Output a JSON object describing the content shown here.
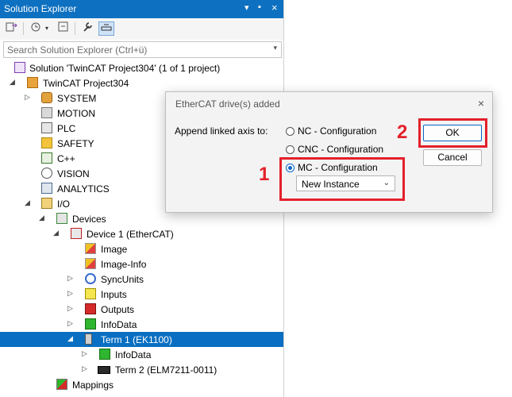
{
  "solution_explorer": {
    "title": "Solution Explorer",
    "title_controls": [
      "▾",
      "▪",
      "×"
    ],
    "search_placeholder": "Search Solution Explorer (Ctrl+ü)",
    "tree": [
      {
        "label": "Solution 'TwinCAT Project304' (1 of 1 project)",
        "icon": "solution-icon"
      },
      {
        "label": "TwinCAT Project304",
        "icon": "project-icon"
      },
      {
        "label": "SYSTEM",
        "icon": "system-icon"
      },
      {
        "label": "MOTION",
        "icon": "motion-icon"
      },
      {
        "label": "PLC",
        "icon": "plc-icon"
      },
      {
        "label": "SAFETY",
        "icon": "safety-icon"
      },
      {
        "label": "C++",
        "icon": "cpp-icon"
      },
      {
        "label": "VISION",
        "icon": "vision-icon"
      },
      {
        "label": "ANALYTICS",
        "icon": "analytics-icon"
      },
      {
        "label": "I/O",
        "icon": "io-icon"
      },
      {
        "label": "Devices",
        "icon": "devices-icon"
      },
      {
        "label": "Device 1 (EtherCAT)",
        "icon": "ethercat-device-icon"
      },
      {
        "label": "Image",
        "icon": "image-icon"
      },
      {
        "label": "Image-Info",
        "icon": "image-info-icon"
      },
      {
        "label": "SyncUnits",
        "icon": "syncunits-icon"
      },
      {
        "label": "Inputs",
        "icon": "inputs-icon"
      },
      {
        "label": "Outputs",
        "icon": "outputs-icon"
      },
      {
        "label": "InfoData",
        "icon": "infodata-icon"
      },
      {
        "label": "Term 1 (EK1100)",
        "icon": "terminal-icon"
      },
      {
        "label": "InfoData",
        "icon": "infodata-icon"
      },
      {
        "label": "Term 2 (ELM7211-0011)",
        "icon": "terminal-icon"
      },
      {
        "label": "Mappings",
        "icon": "mappings-icon"
      }
    ]
  },
  "dialog": {
    "title": "EtherCAT drive(s) added",
    "close": "×",
    "append_label": "Append linked axis to:",
    "options": [
      {
        "label": "NC - Configuration",
        "selected": false
      },
      {
        "label": "CNC - Configuration",
        "selected": false
      },
      {
        "label": "MC - Configuration",
        "selected": true
      }
    ],
    "instance_value": "New Instance",
    "ok_label": "OK",
    "cancel_label": "Cancel"
  },
  "annotations": {
    "step1": "1",
    "step2": "2"
  },
  "colors": {
    "accent": "#0a6fc2",
    "highlight": "#e3202a"
  }
}
